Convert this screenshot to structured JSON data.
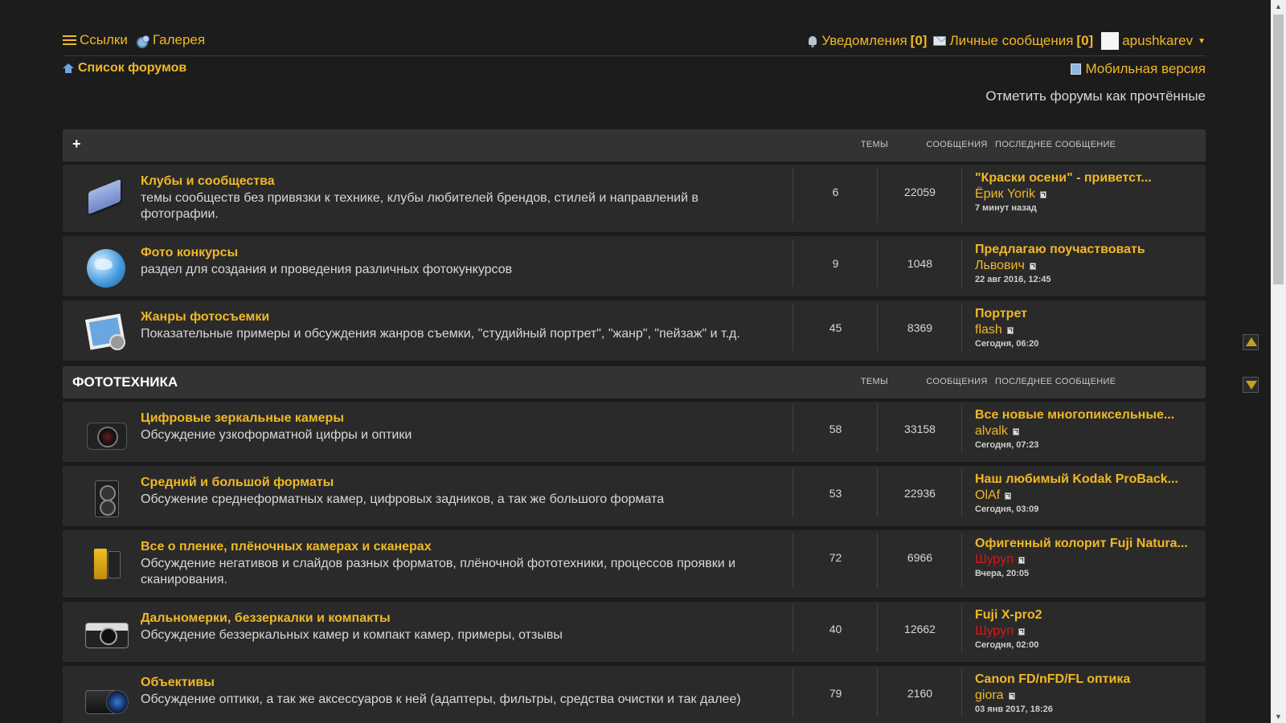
{
  "nav": {
    "links_label": "Ссылки",
    "gallery_label": "Галерея",
    "notifications_label": "Уведомления",
    "notifications_count": "[0]",
    "messages_label": "Личные сообщения",
    "messages_count": "[0]",
    "username": "apushkarev"
  },
  "breadcrumb": {
    "label": "Список форумов"
  },
  "mobile_label": "Мобильная версия",
  "mark_read_label": "Отметить форумы как прочтённые",
  "columns": {
    "topics": "Темы",
    "posts": "Сообщения",
    "last": "Последнее сообщение"
  },
  "category1": {
    "toggle": "+",
    "forums": [
      {
        "title": "Клубы и сообщества",
        "desc": "темы сообществ без привязки к технике, клубы любителей брендов, стилей и направлений в фотографии.",
        "topics": "6",
        "posts": "22059",
        "last_title": "\"Краски осени\" - приветст...",
        "last_author": "Ёрик Yorik",
        "last_date": "7 минут назад"
      },
      {
        "title": "Фото конкурсы",
        "desc": "раздел для создания и проведения различных фотокункурсов",
        "topics": "9",
        "posts": "1048",
        "last_title": "Предлагаю поучаствовать",
        "last_author": "Львович",
        "last_date": "22 авг 2016, 12:45"
      },
      {
        "title": "Жанры фотосъемки",
        "desc": "Показательные примеры и обсуждения жанров съемки, \"студийный портрет\", \"жанр\", \"пейзаж\" и т.д.",
        "topics": "45",
        "posts": "8369",
        "last_title": "Портрет",
        "last_author": "flash",
        "last_date": "Сегодня, 06:20"
      }
    ]
  },
  "category2": {
    "title": "ФОТОТЕХНИКА",
    "forums": [
      {
        "title": "Цифровые зеркальные камеры",
        "desc": "Обсуждение узкоформатной цифры и оптики",
        "topics": "58",
        "posts": "33158",
        "last_title": "Все новые многопиксельные...",
        "last_author": "alvalk",
        "last_date": "Сегодня, 07:23"
      },
      {
        "title": "Средний и большой форматы",
        "desc": "Обсужение среднеформатных камер, цифровых задников, а так же большого формата",
        "topics": "53",
        "posts": "22936",
        "last_title": "Наш любимый Kodak ProBack...",
        "last_author": "OlAf",
        "last_date": "Сегодня, 03:09"
      },
      {
        "title": "Все о пленке, плёночных камерах и сканерах",
        "desc": "Обсуждение негативов и слайдов разных форматов, плёночной фототехники, процессов проявки и сканирования.",
        "topics": "72",
        "posts": "6966",
        "last_title": "Офигенный колорит Fuji Natura...",
        "last_author": "Шуруп",
        "last_date": "Вчера, 20:05"
      },
      {
        "title": "Дальномерки, беззеркалки и компакты",
        "desc": "Обсуждение беззеркальных камер и компакт камер, примеры, отзывы",
        "topics": "40",
        "posts": "12662",
        "last_title": "Fuji X-pro2",
        "last_author": "Шуруп",
        "last_date": "Сегодня, 02:00"
      },
      {
        "title": "Объективы",
        "desc": "Обсуждение оптики, а так же аксессуаров к ней (адаптеры, фильтры, средства очистки и так далее)",
        "topics": "79",
        "posts": "2160",
        "last_title": "Canon FD/nFD/FL оптика",
        "last_author": "giora",
        "last_date": "03 янв 2017, 18:26"
      }
    ]
  },
  "icons": {
    "c1": [
      "folder-icon",
      "globe-icon",
      "photos-icon"
    ],
    "c2": [
      "dslr-camera-icon",
      "medium-format-camera-icon",
      "film-camera-icon",
      "rangefinder-camera-icon",
      "lens-icon"
    ]
  },
  "colors": {
    "accent": "#f0b826",
    "background": "#1c1c1c",
    "row": "#2a2a2a",
    "header": "#333333",
    "moderator": "#d11a1a"
  }
}
